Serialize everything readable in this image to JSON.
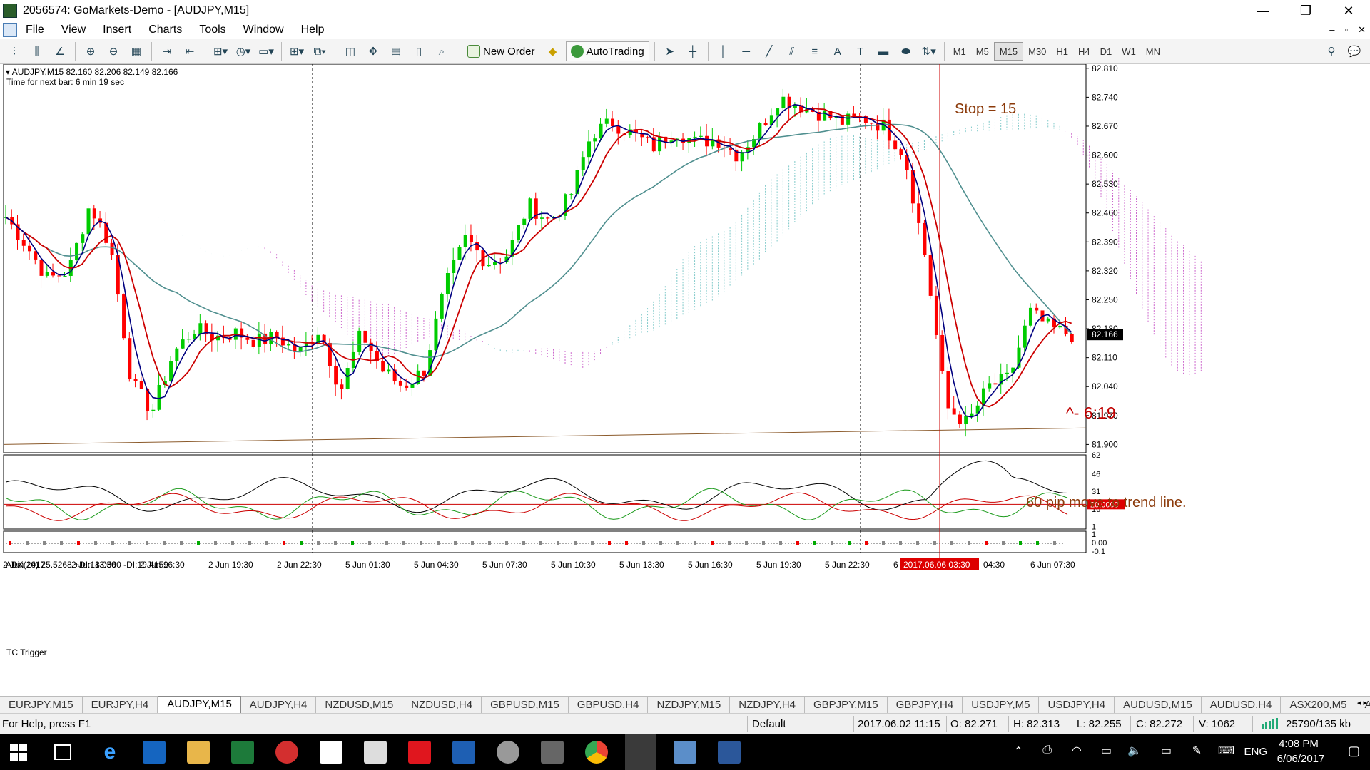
{
  "window": {
    "title": "2056574: GoMarkets-Demo - [AUDJPY,M15]",
    "controls": [
      "—",
      "❐",
      "✕"
    ]
  },
  "menu": {
    "items": [
      "File",
      "View",
      "Insert",
      "Charts",
      "Tools",
      "Window",
      "Help"
    ],
    "mdi_controls": [
      "–",
      "▫",
      "✕"
    ]
  },
  "toolbar": {
    "new_order": "New Order",
    "autotrading": "AutoTrading",
    "timeframes": [
      "M1",
      "M5",
      "M15",
      "M30",
      "H1",
      "H4",
      "D1",
      "W1",
      "MN"
    ],
    "active_timeframe": "M15"
  },
  "chart": {
    "symbol_info": "AUDJPY,M15  82.160 82.206 82.149 82.166",
    "timer": "Time for next bar: 6 min 19 sec",
    "current_price": "82.166",
    "price_ticks": [
      "82.810",
      "82.740",
      "82.670",
      "82.600",
      "82.530",
      "82.460",
      "82.390",
      "82.320",
      "82.250",
      "82.180",
      "82.110",
      "82.040",
      "81.970",
      "81.900"
    ],
    "time_ticks": [
      "2 Jun 2017",
      "2 Jun 13:30",
      "2 Jun 16:30",
      "2 Jun 19:30",
      "2 Jun 22:30",
      "5 Jun 01:30",
      "5 Jun 04:30",
      "5 Jun 07:30",
      "5 Jun 10:30",
      "5 Jun 13:30",
      "5 Jun 16:30",
      "5 Jun 19:30",
      "5 Jun 22:30",
      "6",
      "04:30",
      "6 Jun 07:30"
    ],
    "crosshair_time": "2017.06.06 03:30",
    "annotations": {
      "stop": "Stop = 15",
      "timer_note": "^- 6:19",
      "move_note": "60 pip move to trend line."
    }
  },
  "chart_data": [
    {
      "type": "candlestick",
      "title": "AUDJPY,M15",
      "ylim": [
        81.88,
        82.82
      ],
      "approx_close_path": [
        82.45,
        82.38,
        82.3,
        82.32,
        82.48,
        82.38,
        82.05,
        81.98,
        82.12,
        82.18,
        82.16,
        82.17,
        82.15,
        82.16,
        82.12,
        82.18,
        82.03,
        82.17,
        82.08,
        82.04,
        82.08,
        82.28,
        82.4,
        82.34,
        82.36,
        82.48,
        82.44,
        82.5,
        82.65,
        82.68,
        82.65,
        82.62,
        82.66,
        82.63,
        82.64,
        82.6,
        82.66,
        82.74,
        82.72,
        82.7,
        82.68,
        82.69,
        82.67,
        82.6,
        82.35,
        81.99,
        81.95,
        82.04,
        82.06,
        82.22,
        82.18,
        82.166
      ],
      "indicators": [
        "MA fast (blue)",
        "MA red",
        "MA slow (teal)",
        "Ichimoku cloud"
      ],
      "trend_line": [
        81.9,
        81.94
      ]
    },
    {
      "type": "line",
      "title": "ADX(14) 25.5268 +DI:18.0560 -DI:19.4159",
      "ylim": [
        -1,
        62
      ],
      "y_ticks": [
        "62",
        "46",
        "31",
        "16",
        "1"
      ],
      "level_label": "20.0000",
      "level": 20
    },
    {
      "type": "marker-strip",
      "title": "TC Trigger",
      "y_ticks": [
        "1",
        "0.00",
        "-0.1"
      ]
    }
  ],
  "tabs": [
    "EURJPY,M15",
    "EURJPY,H4",
    "AUDJPY,M15",
    "AUDJPY,H4",
    "NZDUSD,M15",
    "NZDUSD,H4",
    "GBPUSD,M15",
    "GBPUSD,H4",
    "NZDJPY,M15",
    "NZDJPY,H4",
    "GBPJPY,M15",
    "GBPJPY,H4",
    "USDJPY,M5",
    "USDJPY,H4",
    "AUDUSD,M15",
    "AUDUSD,H4",
    "ASX200,M5",
    "ASX2("
  ],
  "active_tab": "AUDJPY,M15",
  "status": {
    "help": "For Help, press F1",
    "profile": "Default",
    "datetime": "2017.06.02 11:15",
    "open": "O: 82.271",
    "high": "H: 82.313",
    "low": "L: 82.255",
    "close": "C: 82.272",
    "volume": "V: 1062",
    "traffic": "25790/135 kb"
  },
  "taskbar": {
    "lang": "ENG",
    "time": "4:08 PM",
    "date": "6/06/2017"
  },
  "colors": {
    "bull": "#00cc00",
    "bear": "#ff0000",
    "ma_fast": "#000080",
    "ma_mid": "#cc0000",
    "ma_slow": "#4f8f8f",
    "cloud_a": "#7fc9c9",
    "cloud_b": "#cc66cc",
    "trend": "#8b5a2b"
  }
}
